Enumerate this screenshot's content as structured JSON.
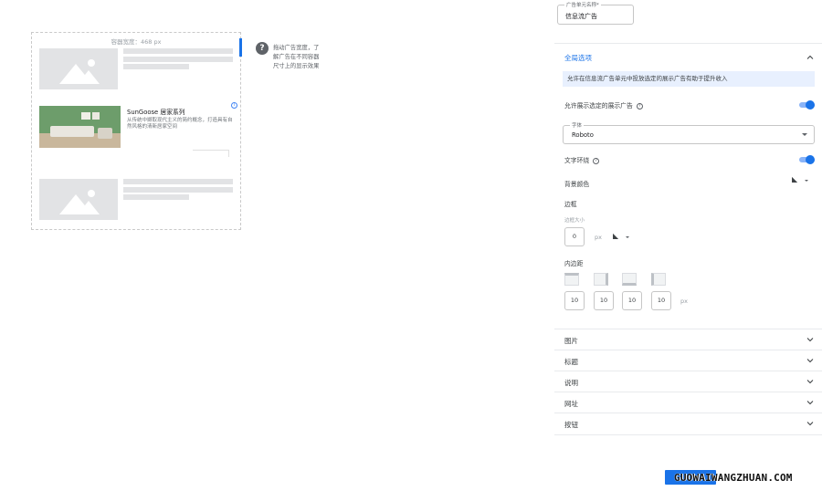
{
  "preview": {
    "width_label": "容器宽度：468 px",
    "ad_title": "SunGoose 居家系列",
    "ad_description": "从传统中撷取现代主义的简约概念，打造具有自然风格的清新居家空间",
    "ad_info_icon": "info-icon",
    "hint_icon": "help-circle-icon",
    "hint_text": "拖动广告宽度，了解广告在不同容器尺寸上的显示效果"
  },
  "panel": {
    "unit_name": {
      "label": "广告单元名称*",
      "value": "信息流广告"
    },
    "global_options": {
      "title": "全局选项",
      "banner": "允许在信息流广告单元中投放选定的展示广告有助于提升收入",
      "allow_display_ads_label": "允许展示选定的展示广告",
      "allow_display_ads_on": true,
      "font": {
        "label": "字体",
        "value": "Roboto"
      },
      "text_wrap_label": "文字环绕",
      "text_wrap_on": true,
      "background_color_label": "背景颜色",
      "border": {
        "label": "边框",
        "width_label": "边框大小",
        "width_value": "0",
        "unit": "px"
      },
      "padding": {
        "label": "内边距",
        "values": [
          "10",
          "10",
          "10",
          "10"
        ],
        "unit": "px"
      }
    },
    "sections": [
      {
        "label": "图片"
      },
      {
        "label": "标题"
      },
      {
        "label": "说明"
      },
      {
        "label": "网址"
      },
      {
        "label": "按钮"
      }
    ]
  },
  "colors": {
    "accent": "#1a73e8",
    "banner_bg": "#e8f0fe",
    "placeholder": "#e2e3e5"
  },
  "watermark": {
    "text": "GUOWAIWANGZHUAN.COM"
  }
}
